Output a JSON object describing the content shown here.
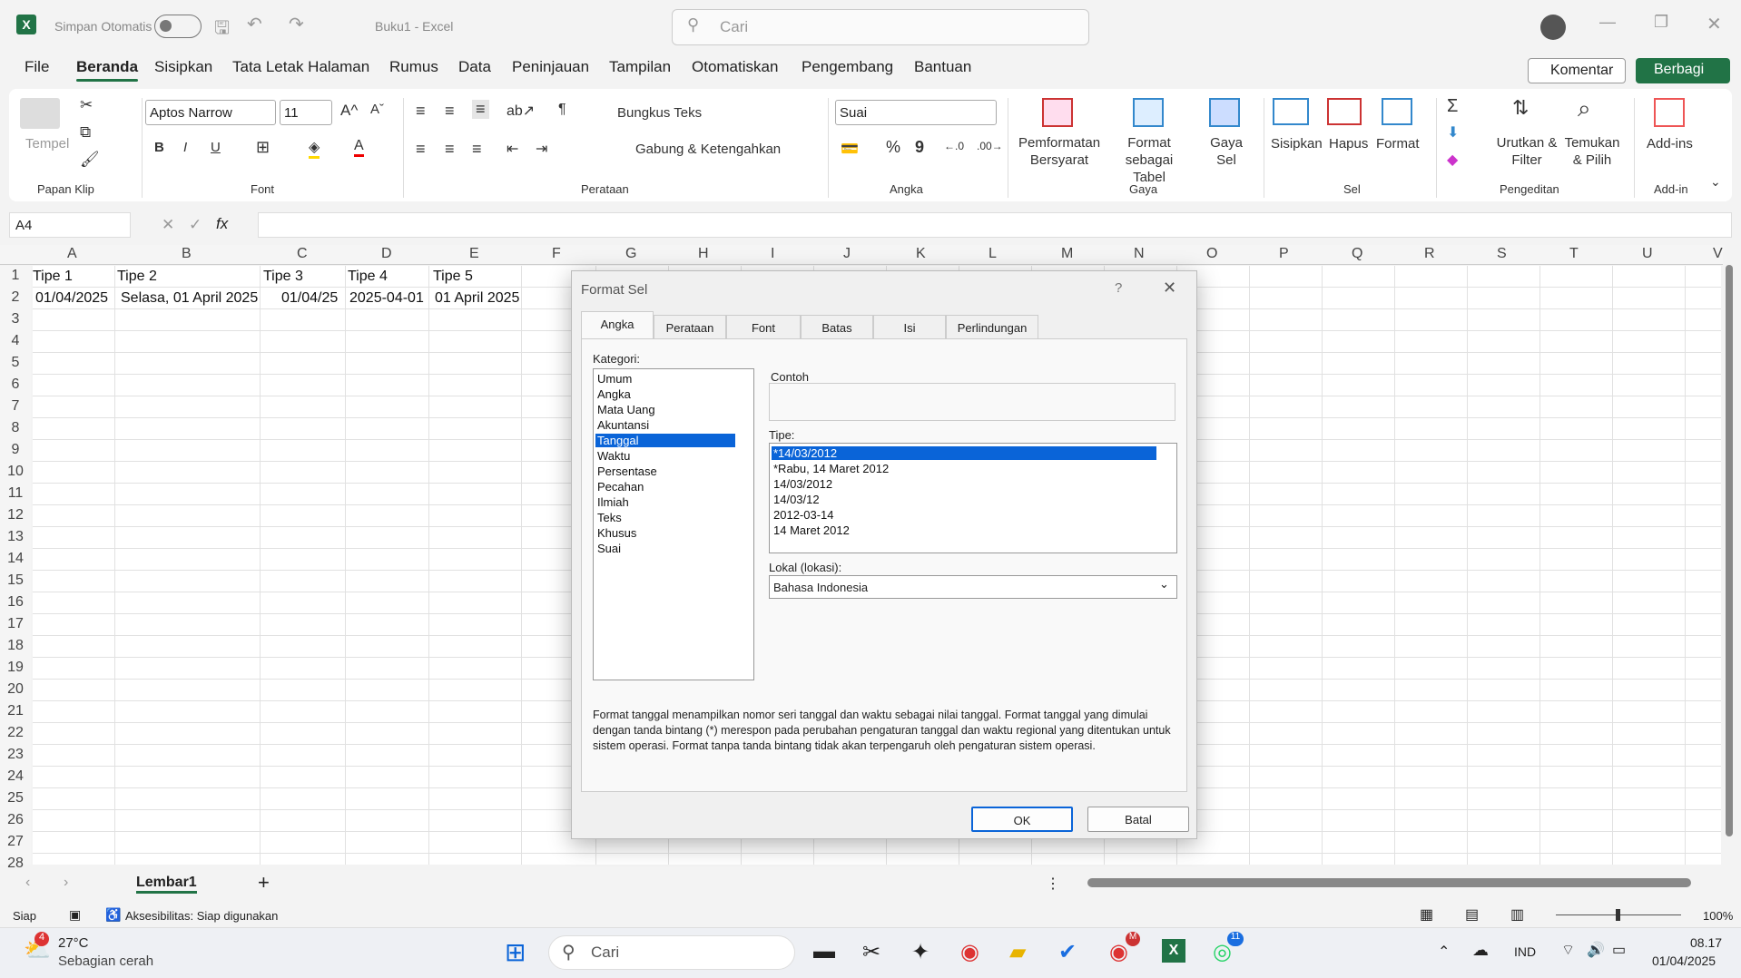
{
  "titlebar": {
    "autosave": "Simpan Otomatis",
    "title": "Buku1  -  Excel",
    "search_placeholder": "Cari"
  },
  "menu": [
    "File",
    "Beranda",
    "Sisipkan",
    "Tata Letak Halaman",
    "Rumus",
    "Data",
    "Peninjauan",
    "Tampilan",
    "Otomatiskan",
    "Pengembang",
    "Bantuan"
  ],
  "top_buttons": {
    "comment": "Komentar",
    "share": "Berbagi"
  },
  "ribbon": {
    "clipboard": {
      "paste": "Tempel",
      "label": "Papan Klip"
    },
    "font": {
      "name": "Aptos Narrow",
      "size": "11",
      "label": "Font"
    },
    "alignment": {
      "wrap": "Bungkus Teks",
      "merge": "Gabung & Ketengahkan",
      "label": "Perataan"
    },
    "number": {
      "format": "Suai",
      "label": "Angka"
    },
    "styles": {
      "cond": "Pemformatan Bersyarat",
      "table": "Format sebagai Tabel",
      "cell_styles": "Gaya Sel",
      "label": "Gaya"
    },
    "cells": {
      "insert": "Sisipkan",
      "delete": "Hapus",
      "format": "Format",
      "label": "Sel"
    },
    "editing": {
      "sort": "Urutkan & Filter",
      "find": "Temukan & Pilih",
      "label": "Pengeditan"
    },
    "addins": {
      "button": "Add-ins",
      "label": "Add-in"
    }
  },
  "namebox": "A4",
  "columns": [
    "A",
    "B",
    "C",
    "D",
    "E",
    "F",
    "G",
    "H",
    "I",
    "J",
    "K",
    "L",
    "M",
    "N",
    "O",
    "P",
    "Q",
    "R",
    "S",
    "T",
    "U",
    "V"
  ],
  "rows": [
    "1",
    "2",
    "3",
    "4",
    "5",
    "6",
    "7",
    "8",
    "9",
    "10",
    "11",
    "12",
    "13",
    "14",
    "15",
    "16",
    "17",
    "18",
    "19",
    "20",
    "21",
    "22",
    "23",
    "24",
    "25",
    "26",
    "27",
    "28"
  ],
  "cells": {
    "row1": [
      "Tipe 1",
      "Tipe 2",
      "Tipe 3",
      "Tipe 4",
      "Tipe 5"
    ],
    "row2": [
      "01/04/2025",
      "Selasa, 01 April 2025",
      "01/04/25",
      "2025-04-01",
      "01 April 2025"
    ]
  },
  "dialog": {
    "title": "Format Sel",
    "help": "?",
    "tabs": [
      "Angka",
      "Perataan",
      "Font",
      "Batas",
      "Isi",
      "Perlindungan"
    ],
    "category_label": "Kategori:",
    "categories": [
      "Umum",
      "Angka",
      "Mata Uang",
      "Akuntansi",
      "Tanggal",
      "Waktu",
      "Persentase",
      "Pecahan",
      "Ilmiah",
      "Teks",
      "Khusus",
      "Suai"
    ],
    "selected_category": "Tanggal",
    "sample_label": "Contoh",
    "type_label": "Tipe:",
    "types": [
      "*14/03/2012",
      "*Rabu, 14 Maret 2012",
      "14/03/2012",
      "14/03/12",
      "2012-03-14",
      "14 Maret 2012"
    ],
    "locale_label": "Lokal (lokasi):",
    "locale_value": "Bahasa Indonesia",
    "description": "Format tanggal menampilkan nomor seri tanggal dan waktu sebagai nilai tanggal. Format tanggal yang dimulai dengan tanda bintang (*) merespon pada perubahan pengaturan tanggal dan waktu regional yang ditentukan untuk sistem operasi. Format tanpa tanda bintang tidak akan terpengaruh oleh pengaturan sistem operasi.",
    "ok": "OK",
    "cancel": "Batal"
  },
  "sheet_tab": "Lembar1",
  "status": {
    "ready": "Siap",
    "accessibility": "Aksesibilitas: Siap digunakan",
    "zoom": "100%"
  },
  "taskbar": {
    "weather_temp": "27°C",
    "weather_desc": "Sebagian cerah",
    "weather_badge": "4",
    "search": "Cari",
    "lang": "IND",
    "time": "08.17",
    "date": "01/04/2025",
    "whatsapp_badge": "11",
    "chrome_badge": "M"
  },
  "colors": {
    "excel_green": "#217346",
    "selection_blue": "#0a64d8"
  }
}
